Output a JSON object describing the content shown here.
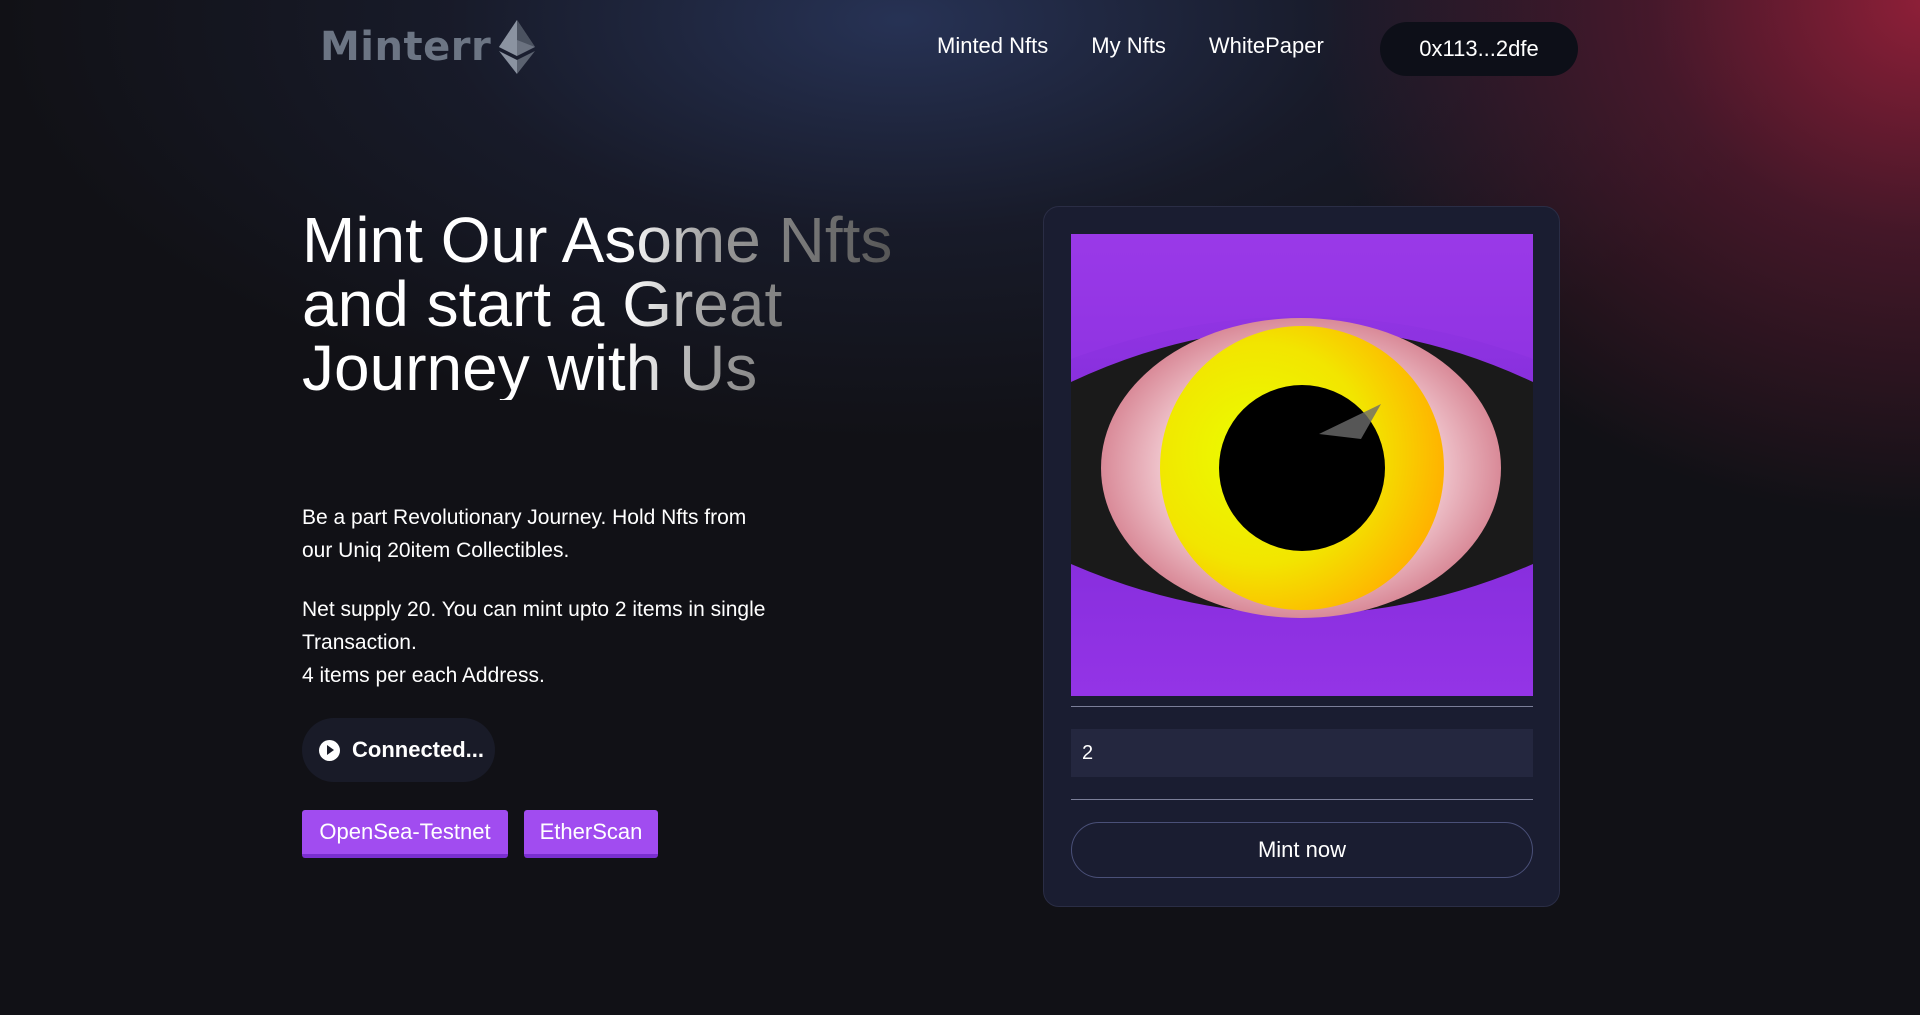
{
  "brand": {
    "name": "Minterr",
    "icon": "ethereum-icon"
  },
  "nav": {
    "links": [
      "Minted Nfts",
      "My Nfts",
      "WhitePaper"
    ],
    "wallet_address": "0x113...2dfe"
  },
  "hero": {
    "title": "Mint Our Asome Nfts and start a Great Journey with Us",
    "description_1": "Be a part Revolutionary Journey. Hold Nfts from our Uniq 20item Collectibles.",
    "description_2": "Net supply 20. You can mint upto 2 items in single Transaction.",
    "description_3": "4 items per each Address.",
    "status_button": {
      "label": "Connected...",
      "icon": "play-circle-icon"
    },
    "links": {
      "opensea": "OpenSea-Testnet",
      "etherscan": "EtherScan"
    }
  },
  "mint_card": {
    "image_icon": "eye-nft-image",
    "quantity_value": "2",
    "mint_label": "Mint now"
  },
  "colors": {
    "accent_purple": "#a14cf0",
    "card_bg": "#1a1d31",
    "page_bg": "#111116"
  }
}
